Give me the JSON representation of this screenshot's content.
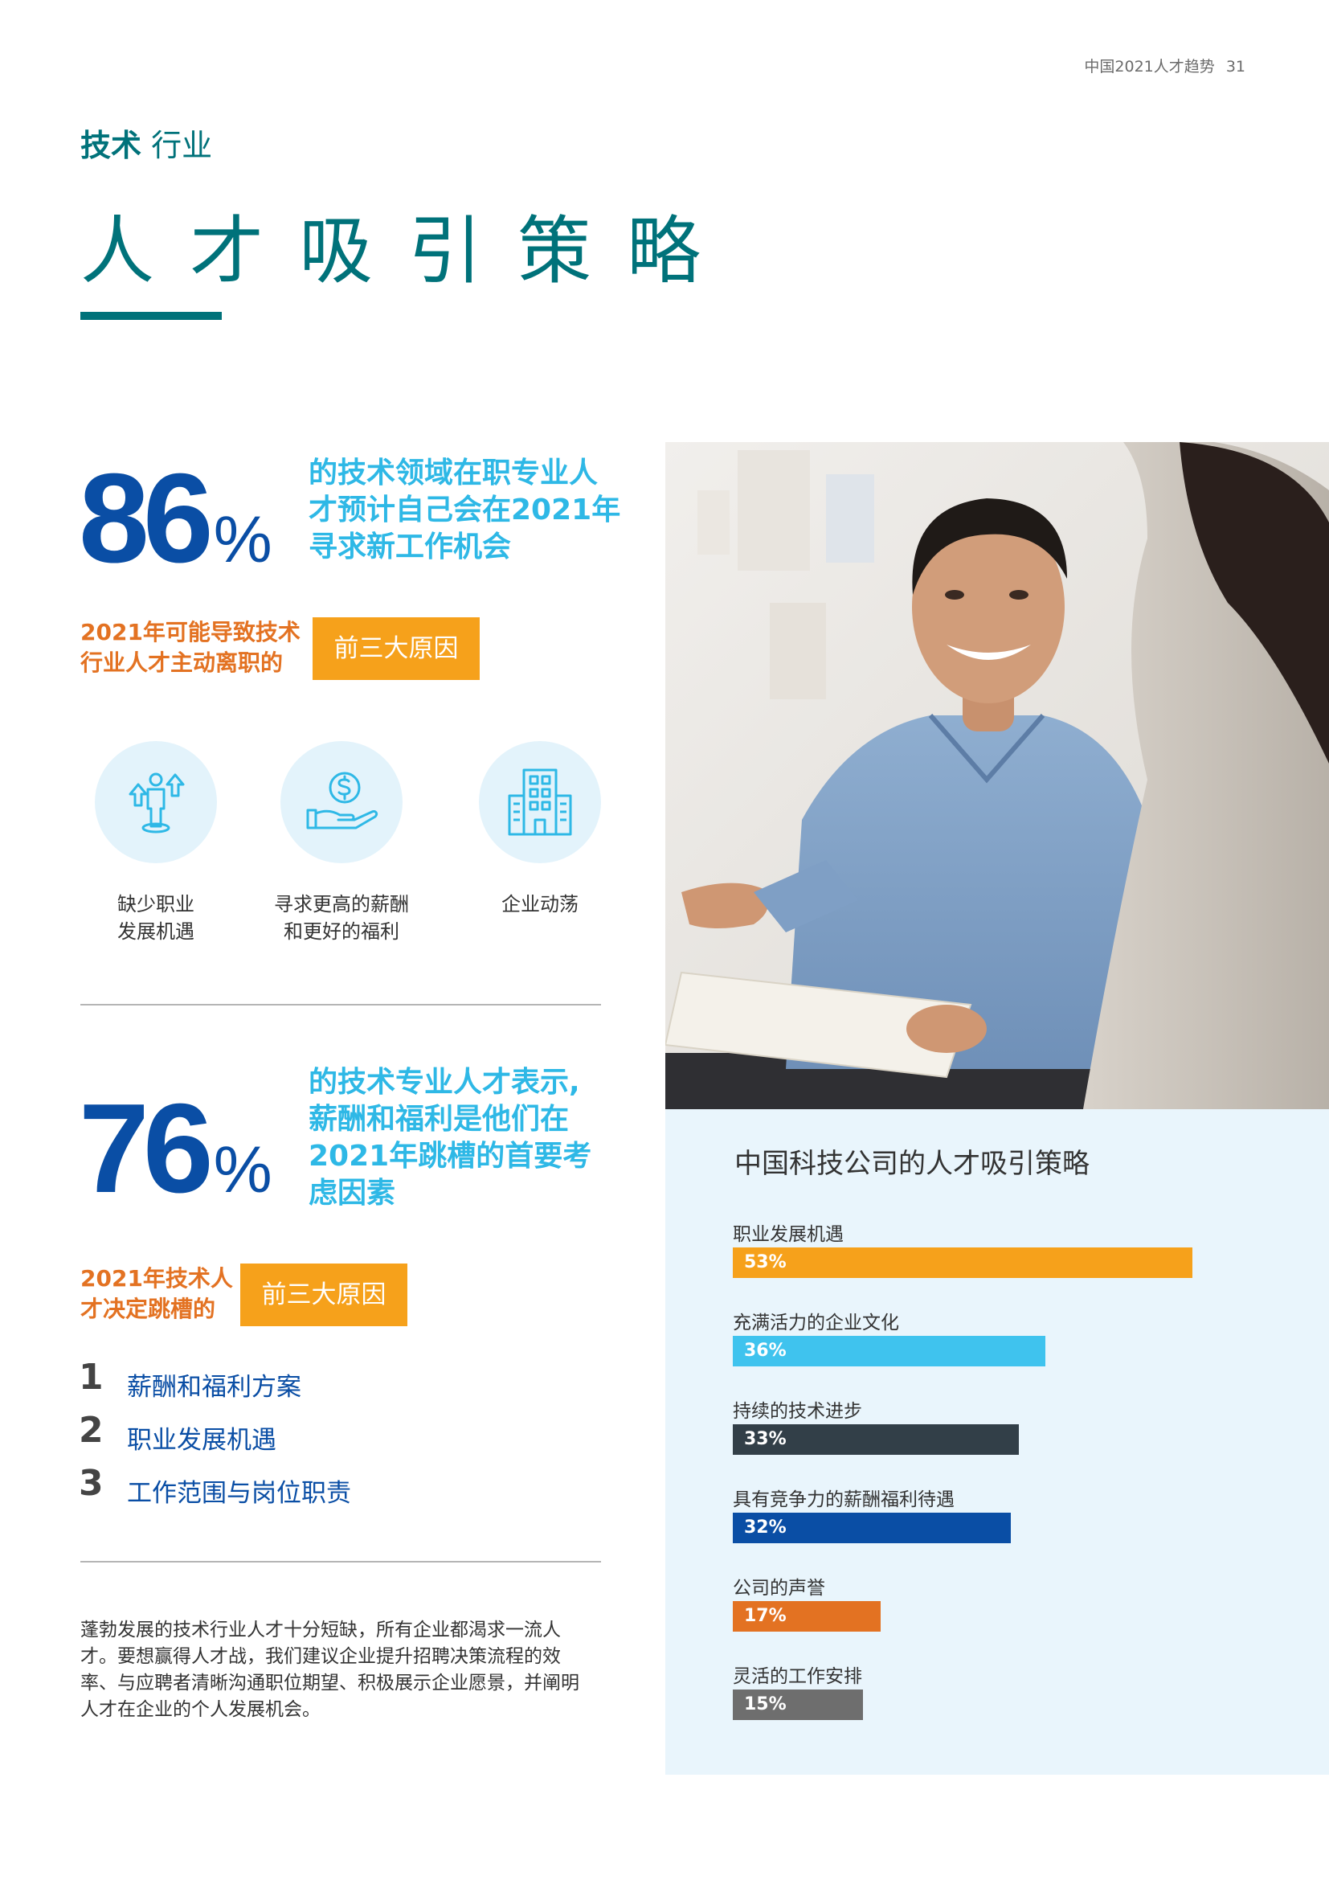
{
  "header": {
    "page_label": "中国2021人才趋势",
    "page_number": "31"
  },
  "section": {
    "tag_bold": "技术",
    "tag_rest": " 行业",
    "title": "人才吸引策略"
  },
  "stat1": {
    "value": "86",
    "unit": "%",
    "desc": [
      "的技术领域在职专业人",
      "才预计自己会在2021年",
      "寻求新工作机会"
    ]
  },
  "reasons_leave": {
    "label": [
      "2021年可能导致技术",
      "行业人才主动离职的"
    ],
    "badge": "前三大原因",
    "items": [
      {
        "icon": "career-up-icon",
        "label": [
          "缺少职业",
          "发展机遇"
        ]
      },
      {
        "icon": "salary-hand-icon",
        "label": [
          "寻求更高的薪酬",
          "和更好的福利"
        ]
      },
      {
        "icon": "office-building-icon",
        "label": [
          "企业动荡",
          ""
        ]
      }
    ]
  },
  "stat2": {
    "value": "76",
    "unit": "%",
    "desc": [
      "的技术专业人才表示,",
      "薪酬和福利是他们在",
      "2021年跳槽的首要考",
      "虑因素"
    ]
  },
  "reasons_switch": {
    "label": [
      "2021年技术人",
      "才决定跳槽的"
    ],
    "badge": "前三大原因",
    "items": [
      {
        "num": "1",
        "text": "薪酬和福利方案"
      },
      {
        "num": "2",
        "text": "职业发展机遇"
      },
      {
        "num": "3",
        "text": "工作范围与岗位职责"
      }
    ]
  },
  "paragraph": "蓬勃发展的技术行业人才十分短缺，所有企业都渴求一流人才。要想赢得人才战，我们建议企业提升招聘决策流程的效率、与应聘者清晰沟通职位期望、积极展示企业愿景，并阐明人才在企业的个人发展机会。",
  "chart_data": {
    "type": "bar",
    "orientation": "horizontal",
    "title": "中国科技公司的人才吸引策略",
    "categories": [
      "职业发展机遇",
      "充满活力的企业文化",
      "持续的技术进步",
      "具有竞争力的薪酬福利待遇",
      "公司的声誉",
      "灵活的工作安排"
    ],
    "values": [
      53,
      36,
      33,
      32,
      17,
      15
    ],
    "labels": [
      "53%",
      "36%",
      "33%",
      "32%",
      "17%",
      "15%"
    ],
    "colors": [
      "#f6a11b",
      "#3fc3ee",
      "#323f48",
      "#0a4ea5",
      "#e37222",
      "#6e6e6e"
    ],
    "unit": "%"
  }
}
